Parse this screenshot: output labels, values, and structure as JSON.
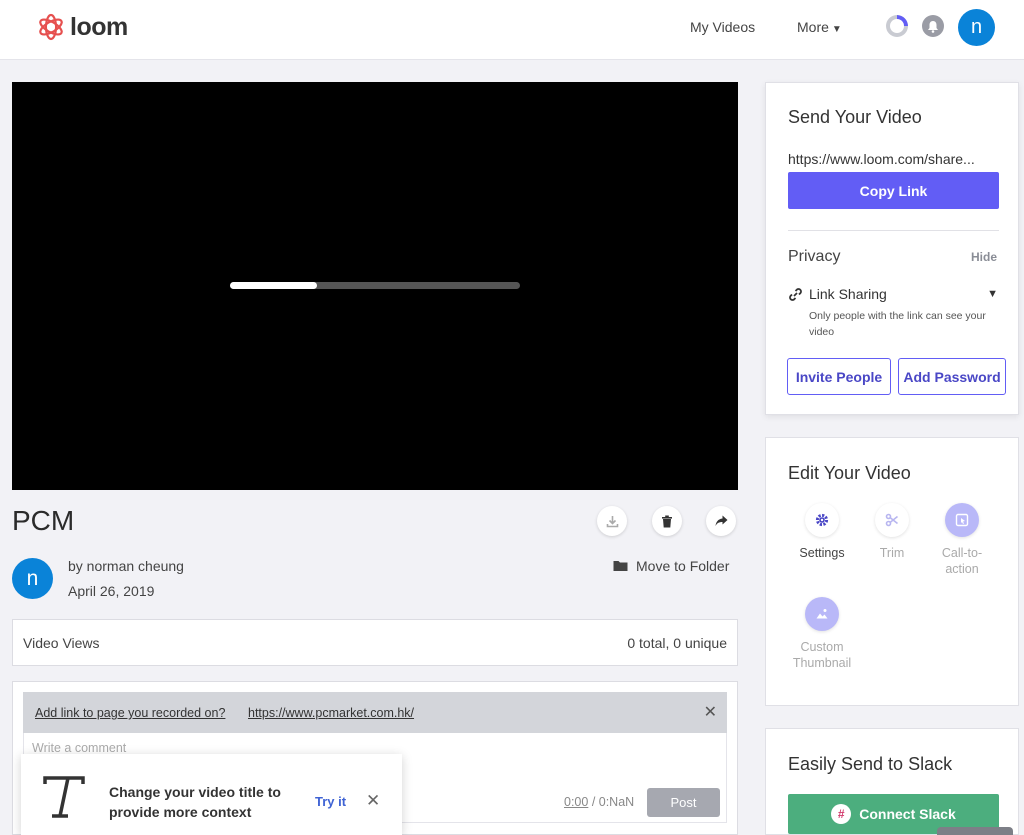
{
  "header": {
    "logo_text": "loom",
    "nav_my_videos": "My Videos",
    "nav_more": "More",
    "avatar_initial": "n"
  },
  "video": {
    "load_progress": 0.3,
    "title": "PCM",
    "owner_initial": "n",
    "owner": "by norman cheung",
    "date": "April 26, 2019",
    "move_to_folder": "Move to Folder"
  },
  "views": {
    "label": "Video Views",
    "value": "0 total, 0 unique"
  },
  "comments": {
    "banner_text": "Add link to page you recorded on?",
    "banner_url": "https://www.pcmarket.com.hk/",
    "placeholder": "Write a comment",
    "time_current": "0:00",
    "time_total": " / 0:NaN",
    "post_label": "Post"
  },
  "toast": {
    "message": "Change your video title to provide more context",
    "try_label": "Try it"
  },
  "send_card": {
    "title": "Send Your Video",
    "share_url": "https://www.loom.com/share...",
    "copy_label": "Copy Link",
    "privacy_title": "Privacy",
    "hide_label": "Hide",
    "link_sharing": "Link Sharing",
    "link_note": "Only people with the link can see your video",
    "invite_label": "Invite People",
    "password_label": "Add Password"
  },
  "edit_card": {
    "title": "Edit Your Video",
    "tools": [
      {
        "label": "Settings"
      },
      {
        "label": "Trim"
      },
      {
        "label": "Call-to-action"
      },
      {
        "label": "Custom Thumbnail"
      }
    ]
  },
  "slack_card": {
    "title": "Easily Send to Slack",
    "button_label": "Connect Slack"
  },
  "colors": {
    "brand_accent": "#625df5",
    "avatar_blue": "#0a83d8",
    "slack_green": "#4cae7e",
    "logo_red": "#e6504f"
  }
}
